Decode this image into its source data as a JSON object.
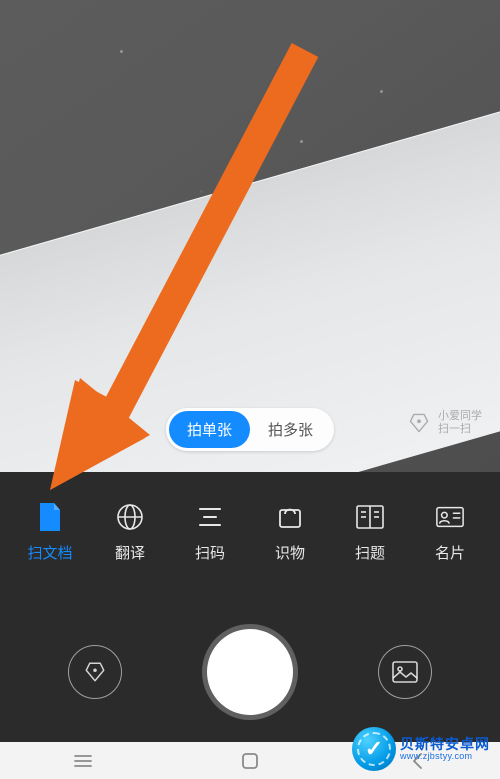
{
  "segments": {
    "single": "拍单张",
    "multi": "拍多张"
  },
  "xiaoai": {
    "line1": "小爱同学",
    "line2": "扫一扫"
  },
  "modes": {
    "doc": "扫文档",
    "trans": "翻译",
    "qr": "扫码",
    "object": "识物",
    "hw": "扫题",
    "card": "名片"
  },
  "watermark": {
    "cn": "贝斯特安卓网",
    "en": "www.zjbstyy.com"
  },
  "colors": {
    "accent": "#148cff",
    "arrow": "#ec6b1f"
  }
}
